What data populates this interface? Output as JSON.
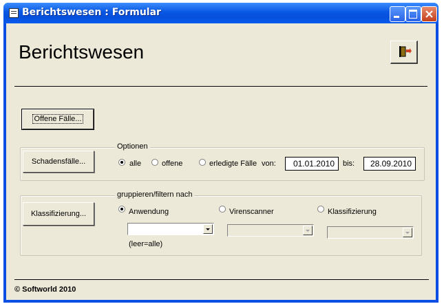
{
  "window": {
    "title": "Berichtswesen : Formular",
    "controls": [
      "minimize-icon",
      "maximize-icon",
      "close-icon"
    ]
  },
  "header": {
    "title": "Berichtswesen",
    "exit_icon": "exit-door-icon"
  },
  "offene_faelle": {
    "button_label": "Offene Fälle..."
  },
  "schadensfaelle": {
    "button_label": "Schadensfälle...",
    "group_label": "Optionen",
    "options": [
      "alle",
      "offene",
      "erledigte Fälle"
    ],
    "selected": "alle",
    "von_label": "von:",
    "von_value": "01.01.2010",
    "bis_label": "bis:",
    "bis_value": "28.09.2010"
  },
  "klassifizierung": {
    "button_label": "Klassifizierung...",
    "group_label": "gruppieren/filtern nach",
    "options": [
      "Anwendung",
      "Virenscanner",
      "Klassifizierung"
    ],
    "selected": "Anwendung",
    "hint": "(leer=alle)"
  },
  "footer": {
    "copyright": "© Softworld 2010"
  }
}
